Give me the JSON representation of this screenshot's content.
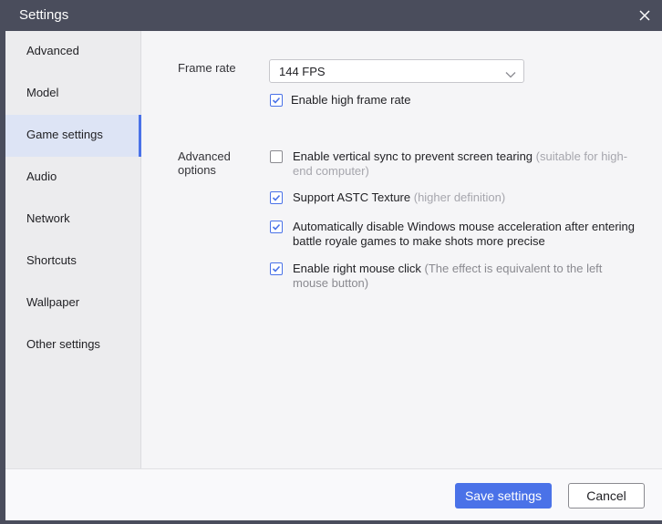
{
  "window": {
    "title": "Settings",
    "close_icon": "close-icon"
  },
  "sidebar": {
    "items": [
      {
        "label": "Advanced",
        "active": false
      },
      {
        "label": "Model",
        "active": false
      },
      {
        "label": "Game settings",
        "active": true
      },
      {
        "label": "Audio",
        "active": false
      },
      {
        "label": "Network",
        "active": false
      },
      {
        "label": "Shortcuts",
        "active": false
      },
      {
        "label": "Wallpaper",
        "active": false
      },
      {
        "label": "Other settings",
        "active": false
      }
    ]
  },
  "frame_rate": {
    "label": "Frame rate",
    "selected": "144 FPS",
    "high_frame_rate": {
      "label": "Enable high frame rate",
      "checked": true
    }
  },
  "advanced_options": {
    "label_line1": "Advanced",
    "label_line2": "options",
    "vsync": {
      "label": "Enable vertical sync to prevent screen tearing",
      "hint_line1": "(suitable for high-",
      "hint_line2": "end computer)",
      "checked": false
    },
    "astc": {
      "label": "Support ASTC Texture",
      "hint": "(higher definition)",
      "checked": true
    },
    "mouse_accel": {
      "label_line1": "Automatically disable Windows mouse acceleration after entering",
      "label_line2": "battle royale games to make shots more precise",
      "checked": true
    },
    "right_click": {
      "label": "Enable right mouse click",
      "hint_line1": "(The effect is equivalent to the left",
      "hint_line2": "mouse button)",
      "checked": true
    }
  },
  "footer": {
    "save_label": "Save settings",
    "cancel_label": "Cancel"
  },
  "colors": {
    "accent": "#4a72e8",
    "titlebar": "#4a4d5c",
    "sidebar_active": "#dde4f5"
  }
}
